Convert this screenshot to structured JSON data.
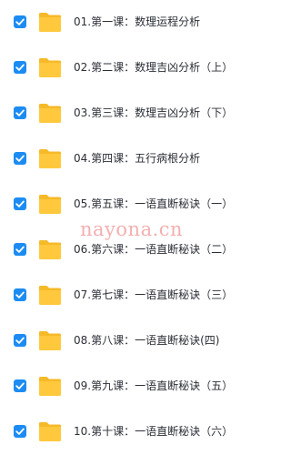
{
  "files": [
    {
      "name": "01.第一课：数理运程分析",
      "checked": true,
      "icon": "folder-icon"
    },
    {
      "name": "02.第二课：数理吉凶分析（上）",
      "checked": true,
      "icon": "folder-icon"
    },
    {
      "name": "03.第三课：数理吉凶分析（下）",
      "checked": true,
      "icon": "folder-icon"
    },
    {
      "name": "04.第四课：五行病根分析",
      "checked": true,
      "icon": "folder-icon"
    },
    {
      "name": "05.第五课：一语直断秘诀（一）",
      "checked": true,
      "icon": "folder-icon"
    },
    {
      "name": "06.第六课：一语直断秘诀（二）",
      "checked": true,
      "icon": "folder-icon"
    },
    {
      "name": "07.第七课：一语直断秘诀（三）",
      "checked": true,
      "icon": "folder-icon"
    },
    {
      "name": "08.第八课：一语直断秘诀(四)",
      "checked": true,
      "icon": "folder-icon"
    },
    {
      "name": "09.第九课：一语直断秘诀（五）",
      "checked": true,
      "icon": "folder-icon"
    },
    {
      "name": "10.第十课：一语直断秘诀（六）",
      "checked": true,
      "icon": "folder-icon"
    }
  ],
  "watermark": "nayona.cn",
  "colors": {
    "checkbox": "#1c8cf3",
    "folder": "#ffc83d",
    "text": "#2b2f36",
    "watermark": "#f2a2a2"
  }
}
